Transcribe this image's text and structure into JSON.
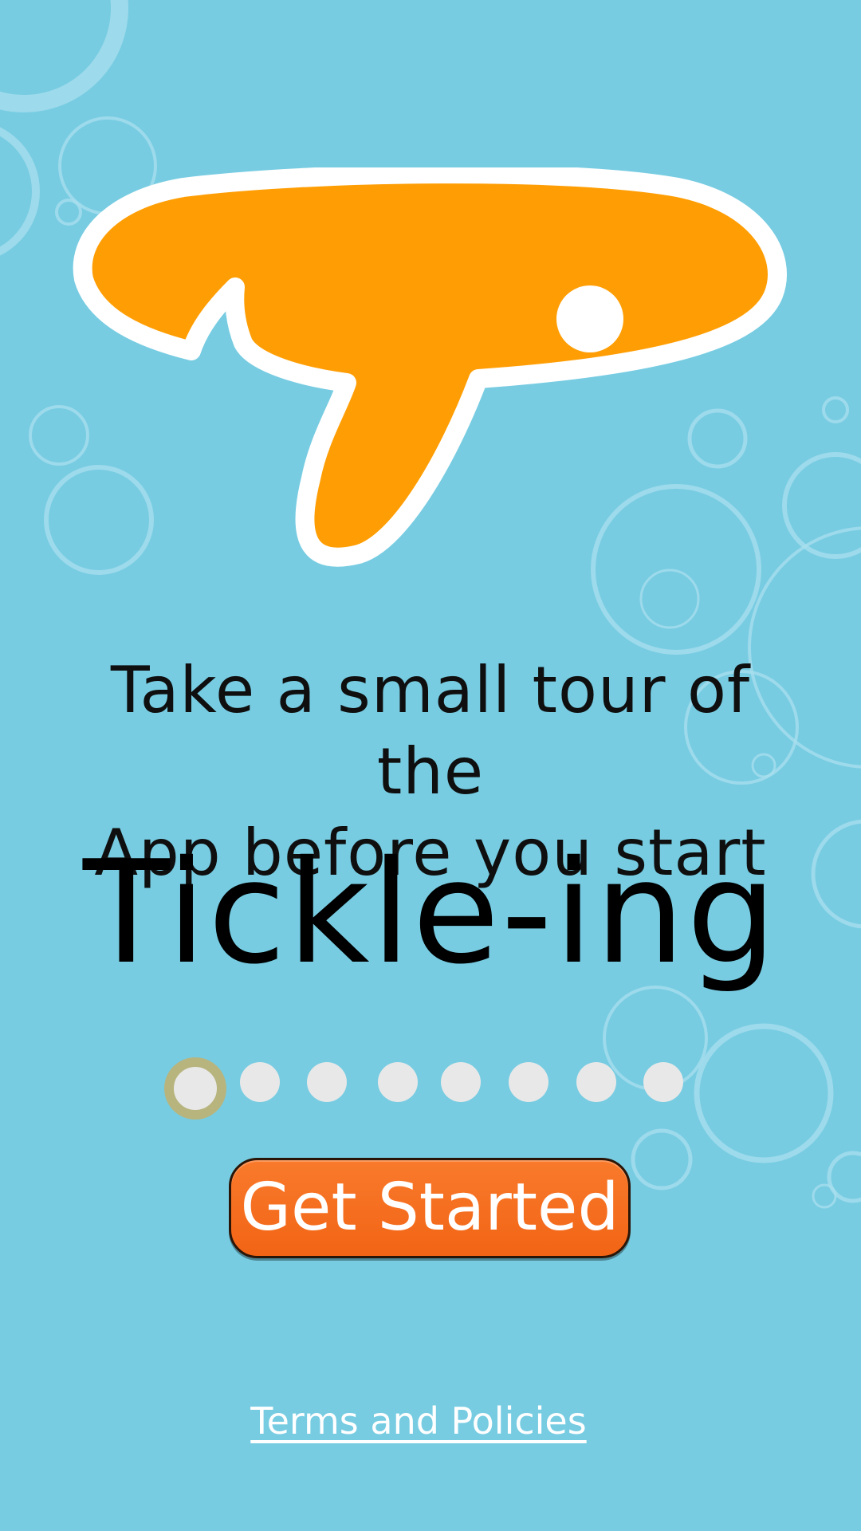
{
  "screen": {
    "background_color": "#77cce2",
    "accent_color": "#f26b1d"
  },
  "logo": {
    "icon": "speech-bubble-logo-icon",
    "color": "#ff9e04",
    "outline_color": "#ffffff"
  },
  "intro": {
    "tagline_line1": "Take a small tour of the",
    "tagline_line2": "App before you start",
    "app_name": "Tickle-ing"
  },
  "pager": {
    "total_pages": 8,
    "current_page": 1
  },
  "actions": {
    "get_started_label": "Get Started",
    "terms_link_label": "Terms and Policies"
  }
}
